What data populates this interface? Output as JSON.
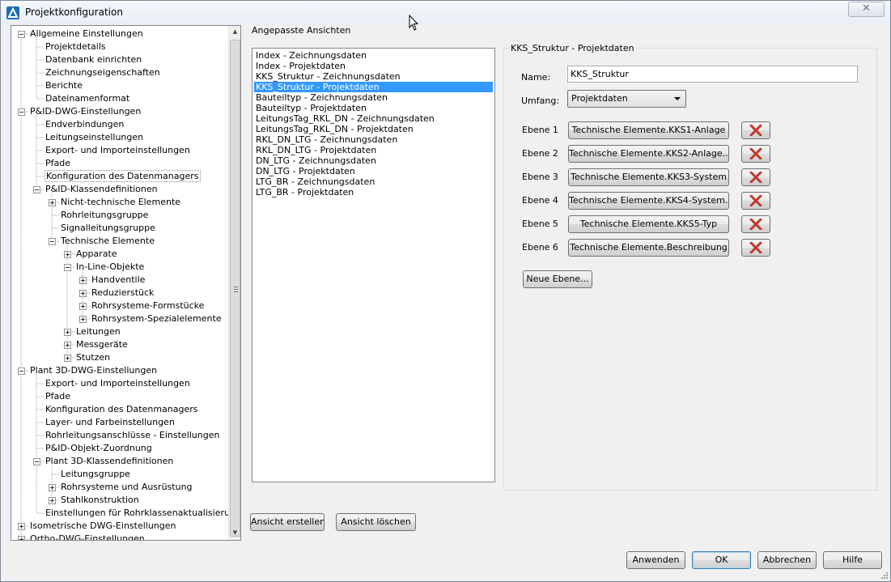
{
  "window": {
    "title": "Projektkonfiguration",
    "close_symbol": "✕"
  },
  "tree": {
    "items": [
      {
        "label": "Allgemeine Einstellungen",
        "level": 0,
        "expander": "minus"
      },
      {
        "label": "Projektdetails",
        "level": 1,
        "expander": "none"
      },
      {
        "label": "Datenbank einrichten",
        "level": 1,
        "expander": "none"
      },
      {
        "label": "Zeichnungseigenschaften",
        "level": 1,
        "expander": "none"
      },
      {
        "label": "Berichte",
        "level": 1,
        "expander": "none"
      },
      {
        "label": "Dateinamenformat",
        "level": 1,
        "expander": "none"
      },
      {
        "label": "P&ID-DWG-Einstellungen",
        "level": 0,
        "expander": "minus"
      },
      {
        "label": "Endverbindungen",
        "level": 1,
        "expander": "none"
      },
      {
        "label": "Leitungseinstellungen",
        "level": 1,
        "expander": "none"
      },
      {
        "label": "Export- und Importeinstellungen",
        "level": 1,
        "expander": "none"
      },
      {
        "label": "Pfade",
        "level": 1,
        "expander": "none"
      },
      {
        "label": "Konfiguration des Datenmanagers",
        "level": 1,
        "expander": "none",
        "selected": true
      },
      {
        "label": "P&ID-Klassendefinitionen",
        "level": 1,
        "expander": "minus"
      },
      {
        "label": "Nicht-technische Elemente",
        "level": 2,
        "expander": "plus"
      },
      {
        "label": "Rohrleitungsgruppe",
        "level": 2,
        "expander": "none"
      },
      {
        "label": "Signalleitungsgruppe",
        "level": 2,
        "expander": "none"
      },
      {
        "label": "Technische Elemente",
        "level": 2,
        "expander": "minus"
      },
      {
        "label": "Apparate",
        "level": 3,
        "expander": "plus"
      },
      {
        "label": "In-Line-Objekte",
        "level": 3,
        "expander": "minus"
      },
      {
        "label": "Handventile",
        "level": 4,
        "expander": "plus"
      },
      {
        "label": "Reduzierstück",
        "level": 4,
        "expander": "plus"
      },
      {
        "label": "Rohrsysteme-Formstücke",
        "level": 4,
        "expander": "plus"
      },
      {
        "label": "Rohrsystem-Spezialelemente",
        "level": 4,
        "expander": "plus"
      },
      {
        "label": "Leitungen",
        "level": 3,
        "expander": "plus"
      },
      {
        "label": "Messgeräte",
        "level": 3,
        "expander": "plus"
      },
      {
        "label": "Stutzen",
        "level": 3,
        "expander": "plus"
      },
      {
        "label": "Plant 3D-DWG-Einstellungen",
        "level": 0,
        "expander": "minus"
      },
      {
        "label": "Export- und Importeinstellungen",
        "level": 1,
        "expander": "none"
      },
      {
        "label": "Pfade",
        "level": 1,
        "expander": "none"
      },
      {
        "label": "Konfiguration des Datenmanagers",
        "level": 1,
        "expander": "none"
      },
      {
        "label": "Layer- und Farbeinstellungen",
        "level": 1,
        "expander": "none"
      },
      {
        "label": "Rohrleitungsanschlüsse - Einstellungen",
        "level": 1,
        "expander": "none"
      },
      {
        "label": "P&ID-Objekt-Zuordnung",
        "level": 1,
        "expander": "none"
      },
      {
        "label": "Plant 3D-Klassendefinitionen",
        "level": 1,
        "expander": "minus"
      },
      {
        "label": "Leitungsgruppe",
        "level": 2,
        "expander": "none"
      },
      {
        "label": "Rohrsysteme und Ausrüstung",
        "level": 2,
        "expander": "plus"
      },
      {
        "label": "Stahlkonstruktion",
        "level": 2,
        "expander": "plus"
      },
      {
        "label": "Einstellungen für Rohrklassenaktualisierung",
        "level": 1,
        "expander": "none"
      },
      {
        "label": "Isometrische DWG-Einstellungen",
        "level": 0,
        "expander": "plus"
      },
      {
        "label": "Ortho-DWG-Einstellungen",
        "level": 0,
        "expander": "plus"
      }
    ]
  },
  "views": {
    "group_label": "Angepasste Ansichten",
    "items": [
      "Index - Zeichnungsdaten",
      "Index - Projektdaten",
      "KKS_Struktur - Zeichnungsdaten",
      "KKS_Struktur - Projektdaten",
      "Bauteiltyp - Zeichnungsdaten",
      "Bauteiltyp - Projektdaten",
      "LeitungsTag_RKL_DN - Zeichnungsdaten",
      "LeitungsTag_RKL_DN - Projektdaten",
      "RKL_DN_LTG - Zeichnungsdaten",
      "RKL_DN_LTG - Projektdaten",
      "DN_LTG - Zeichnungsdaten",
      "DN_LTG - Projektdaten",
      "LTG_BR - Zeichnungsdaten",
      "LTG_BR - Projektdaten"
    ],
    "selected_index": 3,
    "create_button": "Ansicht erstellen",
    "delete_button": "Ansicht löschen"
  },
  "details": {
    "group_label": "KKS_Struktur - Projektdaten",
    "name_label": "Name:",
    "name_value": "KKS_Struktur",
    "scope_label": "Umfang:",
    "scope_value": "Projektdaten",
    "levels": [
      {
        "label": "Ebene 1",
        "value": "Technische Elemente.KKS1-Anlage"
      },
      {
        "label": "Ebene 2",
        "value": "Technische  Elemente.KKS2-Anlage..."
      },
      {
        "label": "Ebene 3",
        "value": "Technische  Elemente.KKS3-System"
      },
      {
        "label": "Ebene 4",
        "value": "Technische  Elemente.KKS4-System..."
      },
      {
        "label": "Ebene 5",
        "value": "Technische Elemente.KKS5-Typ"
      },
      {
        "label": "Ebene 6",
        "value": "Technische Elemente.Beschreibung"
      }
    ],
    "new_level_button": "Neue Ebene..."
  },
  "footer": {
    "apply": "Anwenden",
    "ok": "OK",
    "cancel": "Abbrechen",
    "help": "Hilfe"
  },
  "colors": {
    "selection": "#3399ff",
    "delete_x": "#c0392b"
  },
  "icons": {
    "app": "autocad-plant-icon",
    "delete": "delete-x-icon"
  }
}
